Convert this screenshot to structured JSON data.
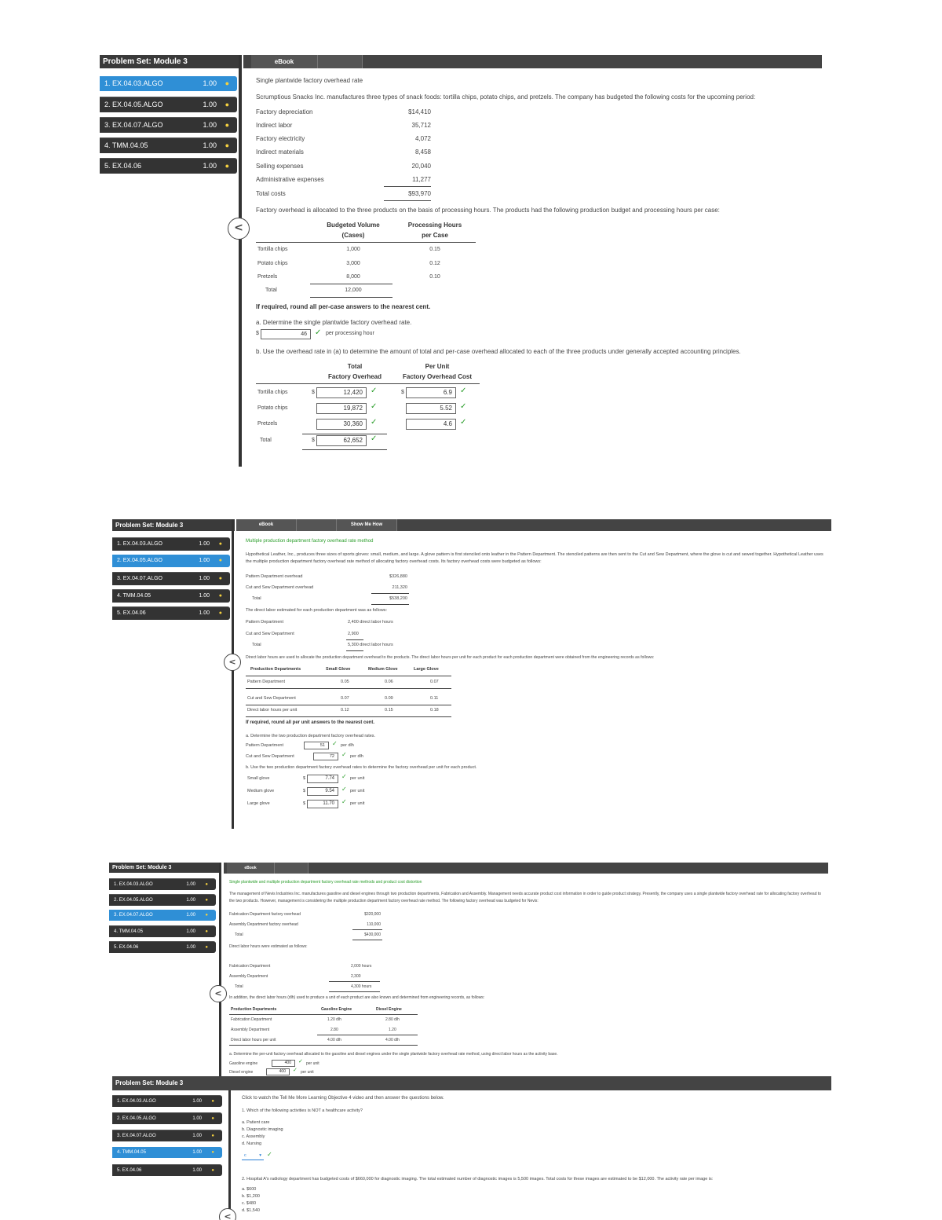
{
  "panel1": {
    "sidebar_title": "Problem Set: Module 3",
    "items": [
      {
        "label": "1. EX.04.03.ALGO",
        "score": "1.00"
      },
      {
        "label": "2. EX.04.05.ALGO",
        "score": "1.00"
      },
      {
        "label": "3. EX.04.07.ALGO",
        "score": "1.00"
      },
      {
        "label": "4. TMM.04.05",
        "score": "1.00"
      },
      {
        "label": "5. EX.04.06",
        "score": "1.00"
      }
    ],
    "tab": "eBook",
    "heading": "Single plantwide factory overhead rate",
    "intro": "Scrumptious Snacks Inc. manufactures three types of snack foods: tortilla chips, potato chips, and pretzels. The company has budgeted the following costs for the upcoming period:",
    "costs": [
      {
        "label": "Factory depreciation",
        "value": "$14,410"
      },
      {
        "label": "Indirect labor",
        "value": "35,712"
      },
      {
        "label": "Factory electricity",
        "value": "4,072"
      },
      {
        "label": "Indirect materials",
        "value": "8,458"
      },
      {
        "label": "Selling expenses",
        "value": "20,040"
      },
      {
        "label": "Administrative expenses",
        "value": "11,277"
      },
      {
        "label": "Total costs",
        "value": "$93,970"
      }
    ],
    "allocation_text": "Factory overhead is allocated to the three products on the basis of processing hours. The products had the following production budget and processing hours per case:",
    "table_head": [
      "Budgeted Volume",
      "(Cases)",
      "Processing Hours",
      "per Case"
    ],
    "products": [
      {
        "label": "Tortilla chips",
        "volume": "1,000",
        "hours": "0.15"
      },
      {
        "label": "Potato chips",
        "volume": "3,000",
        "hours": "0.12"
      },
      {
        "label": "Pretzels",
        "volume": "8,000",
        "hours": "0.10"
      },
      {
        "label": "Total",
        "volume": "12,000",
        "hours": ""
      }
    ],
    "round_note": "If required, round all per-case answers to the nearest cent.",
    "qa": "a.  Determine the single plantwide factory overhead rate.",
    "qa_answer": "46",
    "qa_unit": "per processing hour",
    "qb": "b.  Use the overhead rate in (a) to determine the amount of total and per-case overhead allocated to each of the three products under generally accepted accounting principles.",
    "qb_head": [
      "Total",
      "Factory Overhead",
      "Per Unit",
      "Factory Overhead Cost"
    ],
    "qb_rows": [
      {
        "label": "Tortilla chips",
        "total": "12,420",
        "per": "6.9"
      },
      {
        "label": "Potato chips",
        "total": "19,872",
        "per": "5.52"
      },
      {
        "label": "Pretzels",
        "total": "30,360",
        "per": "4.6"
      },
      {
        "label": "Total",
        "total": "62,652",
        "per": ""
      }
    ]
  },
  "panel2": {
    "sidebar_title": "Problem Set: Module 3",
    "items": [
      {
        "label": "1. EX.04.03.ALGO",
        "score": "1.00"
      },
      {
        "label": "2. EX.04.05.ALGO",
        "score": "1.00"
      },
      {
        "label": "3. EX.04.07.ALGO",
        "score": "1.00"
      },
      {
        "label": "4. TMM.04.05",
        "score": "1.00"
      },
      {
        "label": "5. EX.04.06",
        "score": "1.00"
      }
    ],
    "tabs": [
      "eBook",
      "",
      "Show Me How"
    ],
    "heading": "Multiple production department factory overhead rate method",
    "intro": "Hypothetical Leather, Inc., produces three sizes of sports gloves: small, medium, and large. A glove pattern is first stenciled onto leather in the Pattern Department. The stenciled patterns are then sent to the Cut and Sew Department, where the glove is cut and sewed together. Hypothetical Leather uses the multiple production department factory overhead rate method of allocating factory overhead costs. Its factory overhead costs were budgeted as follows:",
    "costs": [
      {
        "label": "Pattern Department overhead",
        "value": "$326,880"
      },
      {
        "label": "Cut and Sew Department overhead",
        "value": "211,320"
      },
      {
        "label": "Total",
        "value": "$538,200"
      }
    ],
    "dl_text": "The direct labor estimated for each production department was as follows:",
    "dl": [
      {
        "label": "Pattern Department",
        "value": "2,400 direct labor hours"
      },
      {
        "label": "Cut and Sew Department",
        "value": "2,900"
      },
      {
        "label": "Total",
        "value": "5,300 direct labor hours"
      }
    ],
    "dl_text2": "Direct labor hours are used to allocate the production department overhead to the products. The direct labor hours per unit for each product for each production department were obtained from the engineering records as follows:",
    "table_head": [
      "Production Departments",
      "Small Glove",
      "Medium Glove",
      "Large Glove"
    ],
    "table_rows": [
      {
        "label": "Pattern Department",
        "a": "0.05",
        "b": "0.06",
        "c": "0.07"
      },
      {
        "label": "Cut and Sew Department",
        "a": "0.07",
        "b": "0.09",
        "c": "0.11"
      },
      {
        "label": "Direct labor hours per unit",
        "a": "0.12",
        "b": "0.15",
        "c": "0.18"
      }
    ],
    "round_note": "If required, round all per unit answers to the nearest cent.",
    "qa": "a.  Determine the two production department factory overhead rates.",
    "qa_rows": [
      {
        "label": "Pattern Department",
        "value": "51",
        "unit": "per dlh"
      },
      {
        "label": "Cut and Sew Department",
        "value": "72",
        "unit": "per dlh"
      }
    ],
    "qb": "b.  Use the two production department factory overhead rates to determine the factory overhead per unit for each product.",
    "qb_rows": [
      {
        "label": "Small glove",
        "value": "7.74",
        "unit": "per unit"
      },
      {
        "label": "Medium glove",
        "value": "9.54",
        "unit": "per unit"
      },
      {
        "label": "Large glove",
        "value": "11.70",
        "unit": "per unit"
      }
    ]
  },
  "panel3": {
    "sidebar_title": "Problem Set: Module 3",
    "items": [
      {
        "label": "1. EX.04.03.ALGO",
        "score": "1.00"
      },
      {
        "label": "2. EX.04.05.ALGO",
        "score": "1.00"
      },
      {
        "label": "3. EX.04.07.ALGO",
        "score": "1.00"
      },
      {
        "label": "4. TMM.04.05",
        "score": "1.00"
      },
      {
        "label": "5. EX.04.06",
        "score": "1.00"
      }
    ],
    "tab": "eBook",
    "heading": "Single plantwide and multiple production department factory overhead rate methods and product cost distortion",
    "intro": "The management of Nevis Industries Inc. manufactures gasoline and diesel engines through two production departments, Fabrication and Assembly. Management needs accurate product cost information in order to guide product strategy. Presently, the company uses a single plantwide factory overhead rate for allocating factory overhead to the two products. However, management is considering the multiple production department factory overhead rate method. The following factory overhead was budgeted for Nevis:",
    "costs": [
      {
        "label": "Fabrication Department factory overhead",
        "value": "$320,000"
      },
      {
        "label": "Assembly Department factory overhead",
        "value": "110,000"
      },
      {
        "label": "Total",
        "value": "$430,000"
      }
    ],
    "dl_text": "Direct labor hours were estimated as follows:",
    "dl": [
      {
        "label": "Fabrication Department",
        "value": "2,000 hours"
      },
      {
        "label": "Assembly Department",
        "value": "2,300"
      },
      {
        "label": "Total",
        "value": "4,300 hours"
      }
    ],
    "dl_text2": "In addition, the direct labor hours (dlh) used to produce a unit of each product are also known and determined from engineering records, as follows:",
    "table_head": [
      "Production Departments",
      "Gasoline Engine",
      "Diesel Engine"
    ],
    "table_rows": [
      {
        "label": "Fabrication Department",
        "a": "1.20 dlh",
        "b": "2.80 dlh"
      },
      {
        "label": "Assembly Department",
        "a": "2.80",
        "b": "1.20"
      },
      {
        "label": "Direct labor hours per unit",
        "a": "4.00 dlh",
        "b": "4.00 dlh"
      }
    ],
    "qa": "a.  Determine the per-unit factory overhead allocated to the gasoline and diesel engines under the single plantwide factory overhead rate method, using direct labor hours as the activity base.",
    "qa_rows": [
      {
        "label": "Gasoline engine",
        "value": "400",
        "unit": "per unit"
      },
      {
        "label": "Diesel engine",
        "value": "400",
        "unit": "per unit"
      }
    ]
  },
  "panel4": {
    "sidebar_title": "Problem Set: Module 3",
    "items": [
      {
        "label": "1. EX.04.03.ALGO",
        "score": "1.00"
      },
      {
        "label": "2. EX.04.05.ALGO",
        "score": "1.00"
      },
      {
        "label": "3. EX.04.07.ALGO",
        "score": "1.00"
      },
      {
        "label": "4. TMM.04.05",
        "score": "1.00"
      },
      {
        "label": "5. EX.04.06",
        "score": "1.00"
      }
    ],
    "intro": "Click to watch the Tell Me More Learning Objective 4 video and then answer the questions below.",
    "q1": "1.  Which of the following activities is NOT a healthcare activity?",
    "q1_options": [
      "a. Patient care",
      "b. Diagnostic imaging",
      "c. Assembly",
      "d. Nursing"
    ],
    "q1_answer": "c",
    "q2": "2.  Hospital A's radiology department has budgeted costs of $660,000 for diagnostic imaging. The total estimated number of diagnostic images is 5,500 images. Total costs for these images are estimated to be $12,000. The activity rate per image is:",
    "q2_options": [
      "a. $600",
      "b. $1,200",
      "c. $480",
      "d. $1,540"
    ]
  }
}
